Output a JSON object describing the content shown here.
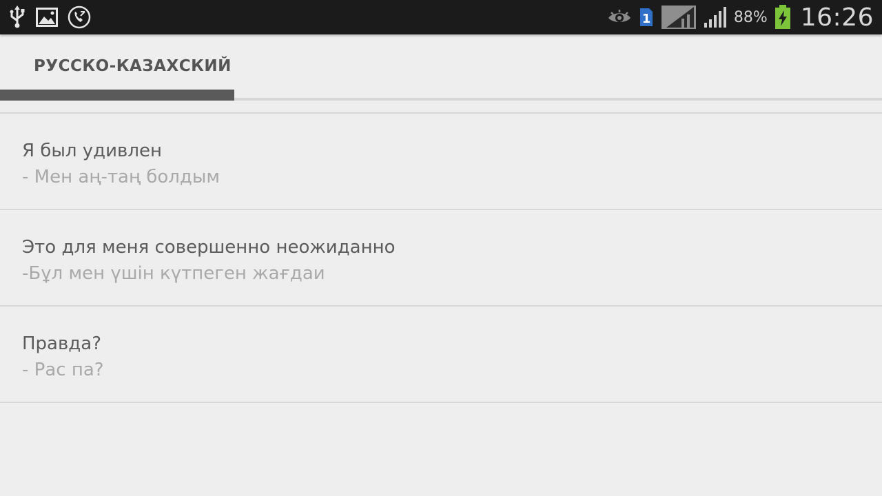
{
  "status_bar": {
    "left_icons": [
      "usb-icon",
      "image-icon",
      "phone-call-icon"
    ],
    "right_icons": [
      "eye-icon",
      "sim-icon",
      "signal-icon-1",
      "signal-icon-2",
      "battery-icon"
    ],
    "sim_number": "1",
    "battery_percent": "88%",
    "time": "16:26"
  },
  "tabs": [
    {
      "label": "РУССКО-КАЗАХСКИЙ",
      "selected": true
    }
  ],
  "phrases": [
    {
      "ru": "Я был удивлен",
      "kz": "- Мен аң-таң болдым"
    },
    {
      "ru": "Это для меня совершенно неожиданно",
      "kz": "-Бұл мен үшін күтпеген жағдаи"
    },
    {
      "ru": "Правда?",
      "kz": "- Рас па?"
    }
  ],
  "colors": {
    "status_bar_bg": "#1b1b1b",
    "background": "#eeeeee",
    "tab_indicator": "#5a5a5a",
    "phrase_text": "#5c5c5c",
    "translation_text": "#a9a9a9",
    "battery_green": "#7cc43a",
    "sim_blue": "#2f6fc7"
  }
}
